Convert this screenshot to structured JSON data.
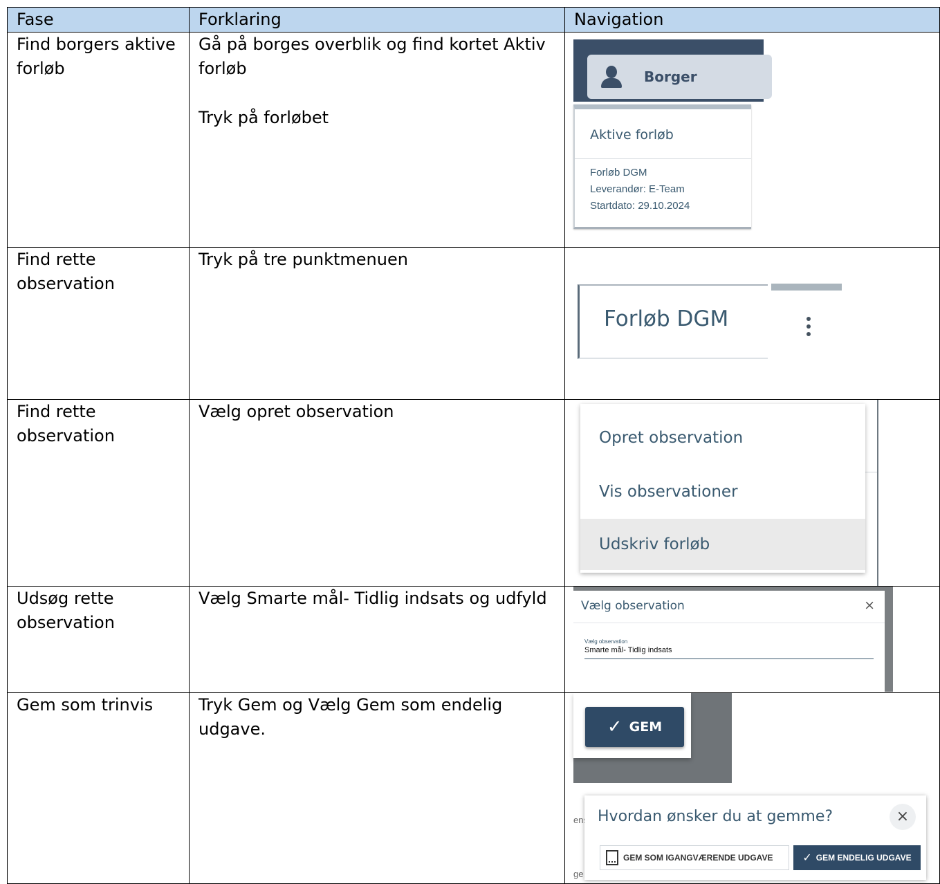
{
  "table": {
    "headers": [
      "Fase",
      "Forklaring",
      "Navigation"
    ],
    "rows": [
      {
        "fase": "Find borgers aktive forløb",
        "forklaring": [
          "Gå på borges overblik og find kortet Aktiv forløb",
          "Tryk på forløbet"
        ]
      },
      {
        "fase": "Find rette observation",
        "forklaring": [
          "Tryk på tre punktmenuen"
        ]
      },
      {
        "fase": "Find rette observation",
        "forklaring": [
          "Vælg opret observation"
        ]
      },
      {
        "fase": "Udsøg rette observation",
        "forklaring": [
          "Vælg Smarte mål- Tidlig indsats og udfyld"
        ]
      },
      {
        "fase": "Gem som trinvis",
        "forklaring": [
          "Tryk Gem og Vælg Gem som endelig udgave."
        ]
      }
    ]
  },
  "nav": {
    "row1": {
      "borger_button": "Borger",
      "card_title": "Aktive forløb",
      "card_lines": [
        "Forløb DGM",
        "Leverandør: E-Team",
        "Startdato: 29.10.2024"
      ]
    },
    "row2": {
      "card_title": "Forløb DGM"
    },
    "row3": {
      "menu_items": [
        "Opret observation",
        "Vis observationer",
        "Udskriv forløb"
      ]
    },
    "row4": {
      "dialog_title": "Vælg observation",
      "close_glyph": "×",
      "field_label": "Vælg observation",
      "field_value": "Smarte mål- Tidlig indsats"
    },
    "row5": {
      "gem_button": "GEM",
      "save_question": "Hvordan ønsker du at gemme?",
      "close_glyph": "×",
      "draft_button": "GEM SOM IGANGVÆRENDE UDGAVE",
      "final_button": "GEM ENDELIG UDGAVE",
      "cut_text_1": "ens",
      "cut_text_2": "ge"
    }
  },
  "colors": {
    "header_bg": "#bdd6ee",
    "app_primary": "#2f4a66",
    "app_text": "#3a5a70"
  }
}
